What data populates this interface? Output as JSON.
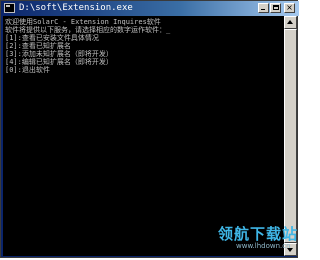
{
  "window": {
    "title": "D:\\soft\\Extension.exe"
  },
  "console": {
    "lines": [
      "欢迎使用SolarC - Extension Inquires软件",
      "软件将提供以下服务，请选择相应的数字运作软件：_",
      "[1]:查看已安装文件具体情况",
      "[2]:查看已知扩展名",
      "[3]:添加未知扩展名（即将开发）",
      "[4]:编辑已知扩展名（即将开发）",
      "[0]:退出软件",
      ""
    ]
  },
  "watermark": {
    "main": "领航下载站",
    "sub": "www.lhdown.cn"
  },
  "colors": {
    "console_bg": "#000000",
    "console_text": "#c0c0c0",
    "titlebar_start": "#0a246a",
    "titlebar_end": "#a6caf0",
    "watermark": "#3fb6e6"
  },
  "icons": {
    "app": "console-app-icon",
    "minimize": "minimize-icon",
    "maximize": "maximize-icon",
    "close": "close-icon",
    "scroll_up": "arrow-up-icon",
    "scroll_down": "arrow-down-icon"
  }
}
